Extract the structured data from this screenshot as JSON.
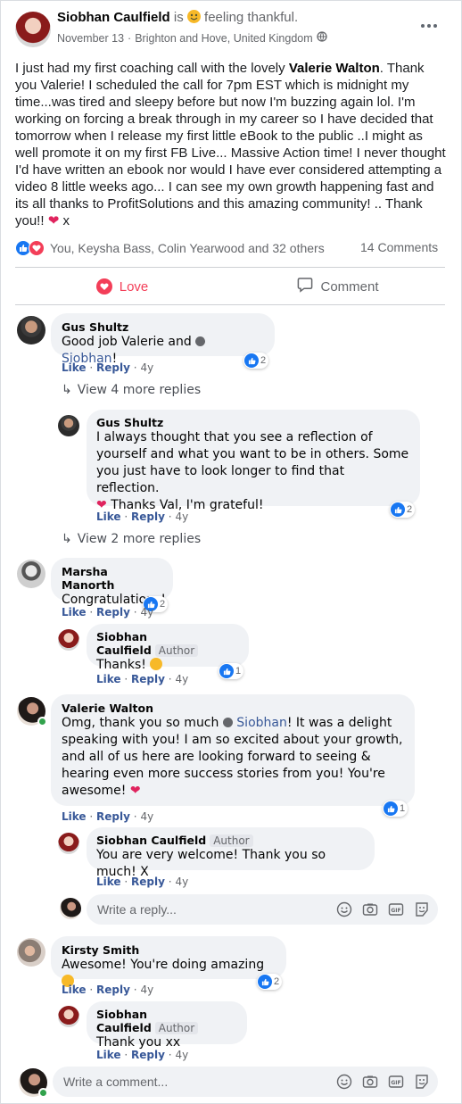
{
  "post": {
    "author": "Siobhan Caulfield",
    "is_word": "is",
    "feeling": "feeling thankful.",
    "date": "November 13",
    "location": "Brighton and Hove, United Kingdom",
    "mention": "Valerie Walton",
    "text_before": "I just had my first coaching call with the lovely",
    "text_after": ". Thank you Valerie! I scheduled the call for 7pm EST which is midnight my time...was tired and sleepy before but now I'm buzzing again lol. I'm working on forcing a break through in my career so I have decided that tomorrow when I release my first little eBook to the public ..I might as well promote it on my first FB Live... Massive Action time! I never thought I'd have written an ebook nor would I have ever considered attempting a video 8 little weeks ago... I can see my own growth happening fast and its all thanks to ProfitSolutions and this amazing community! .. Thank you!!",
    "text_end": "x",
    "reactions_text": "You, Keysha Bass, Colin Yearwood and 32 others",
    "comments_count": "14 Comments",
    "love_label": "Love",
    "comment_label": "Comment"
  },
  "comments": {
    "c1": {
      "name": "Gus Shultz",
      "text_a": "Good job",
      "m1": "Valerie",
      "text_b": "and",
      "m2": "Siobhan",
      "text_c": "!",
      "like": "Like",
      "reply": "Reply",
      "time": "4y",
      "count": "2"
    },
    "more1": "View 4 more replies",
    "c2": {
      "name": "Gus Shultz",
      "text": "I always thought that you see a reflection of yourself and what you want to be in others. Some you just have to look longer to find that reflection.",
      "text2": "Thanks Val, I'm grateful!",
      "like": "Like",
      "reply": "Reply",
      "time": "4y",
      "count": "2"
    },
    "more2": "View 2 more replies",
    "c3": {
      "name": "Marsha Manorth",
      "text": "Congratulations!",
      "like": "Like",
      "reply": "Reply",
      "time": "4y",
      "count": "2"
    },
    "c4": {
      "name": "Siobhan Caulfield",
      "tag": "Author",
      "text": "Thanks!",
      "like": "Like",
      "reply": "Reply",
      "time": "4y",
      "count": "1"
    },
    "c5": {
      "name": "Valerie Walton",
      "text_a": "Omg, thank you so much",
      "m1": "Siobhan",
      "text_b": "! It was a delight speaking with you! I am so excited about your growth, and all of us here are looking forward to seeing & hearing even more success stories from you! You're awesome!",
      "like": "Like",
      "reply": "Reply",
      "time": "4y",
      "count": "1"
    },
    "c6": {
      "name": "Siobhan Caulfield",
      "tag": "Author",
      "text": "You are very welcome! Thank you so much! X",
      "like": "Like",
      "reply": "Reply",
      "time": "4y"
    },
    "reply_placeholder": "Write a reply...",
    "c7": {
      "name": "Kirsty Smith",
      "text": "Awesome! You're doing amazing",
      "like": "Like",
      "reply": "Reply",
      "time": "4y",
      "count": "2"
    },
    "c8": {
      "name": "Siobhan Caulfield",
      "tag": "Author",
      "text": "Thank you xx",
      "like": "Like",
      "reply": "Reply",
      "time": "4y"
    },
    "comment_placeholder": "Write a comment..."
  },
  "icons": [
    "globe-icon",
    "more-options-icon",
    "like-reaction-icon",
    "love-reaction-icon",
    "heart-icon",
    "comment-icon",
    "reply-arrow-icon",
    "verified-icon",
    "emoji-icon",
    "camera-icon",
    "gif-icon",
    "sticker-icon"
  ],
  "colors": {
    "accent": "#1877f2",
    "love": "#f33e58",
    "link": "#385898"
  }
}
